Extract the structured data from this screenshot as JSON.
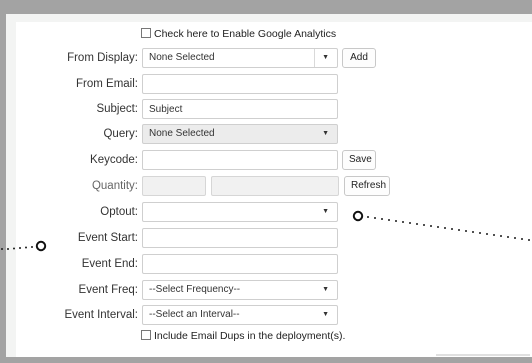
{
  "analytics": {
    "label": "Check here to Enable Google Analytics",
    "checked": false
  },
  "from_display": {
    "label": "From Display:",
    "value": "None Selected",
    "add_label": "Add"
  },
  "from_email": {
    "label": "From Email:",
    "value": ""
  },
  "subject": {
    "label": "Subject:",
    "value": "Subject"
  },
  "query": {
    "label": "Query:",
    "value": "None Selected"
  },
  "keycode": {
    "label": "Keycode:",
    "value": "",
    "save_label": "Save"
  },
  "quantity": {
    "label": "Quantity:",
    "value_a": "",
    "value_b": "",
    "refresh_label": "Refresh"
  },
  "optout": {
    "label": "Optout:",
    "value": ""
  },
  "event_start": {
    "label": "Event Start:",
    "value": ""
  },
  "event_end": {
    "label": "Event End:",
    "value": ""
  },
  "event_freq": {
    "label": "Event Freq:",
    "value": "--Select Frequency--"
  },
  "event_interval": {
    "label": "Event Interval:",
    "value": "--Select an Interval--"
  },
  "email_dups": {
    "label": "Include Email Dups in the deployment(s).",
    "checked": false
  },
  "icons": {
    "dropdown_arrow": "chevron-down-icon",
    "checkbox": "checkbox-icon"
  },
  "colors": {
    "background": "#a3a3a3",
    "panel": "#ffffff",
    "border": "#cfcfcf",
    "accent": "#222222"
  }
}
